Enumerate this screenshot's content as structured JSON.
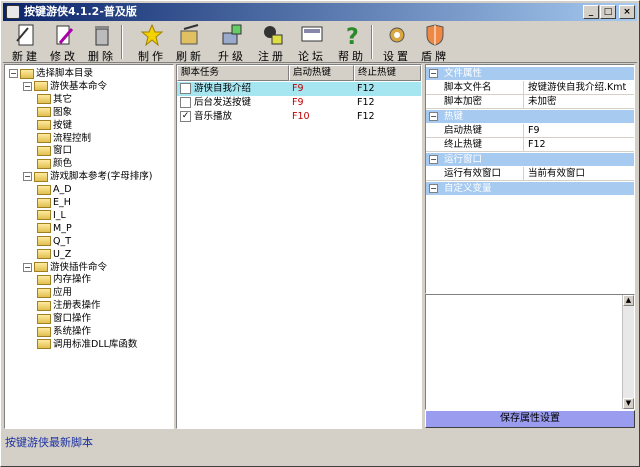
{
  "window": {
    "title": "按键游侠4.1.2-普及版",
    "btn_min": "_",
    "btn_max": "□",
    "btn_close": "×"
  },
  "toolbar": [
    {
      "label": "新建",
      "icon": "new-file-icon"
    },
    {
      "label": "修改",
      "icon": "edit-icon"
    },
    {
      "label": "删除",
      "icon": "trash-icon"
    },
    {
      "label": "制作",
      "icon": "star-icon"
    },
    {
      "label": "刷新",
      "icon": "refresh-icon"
    },
    {
      "label": "升级",
      "icon": "upgrade-icon"
    },
    {
      "label": "注册",
      "icon": "register-icon"
    },
    {
      "label": "论坛",
      "icon": "forum-icon"
    },
    {
      "label": "帮助",
      "icon": "help-icon"
    },
    {
      "label": "设置",
      "icon": "settings-icon"
    },
    {
      "label": "盾牌",
      "icon": "shield-icon"
    }
  ],
  "tree": [
    {
      "label": "选择脚本目录",
      "level": 0,
      "pm": "−"
    },
    {
      "label": "游侠基本命令",
      "level": 1,
      "pm": "−"
    },
    {
      "label": "其它",
      "level": 2
    },
    {
      "label": "图象",
      "level": 2
    },
    {
      "label": "按键",
      "level": 2
    },
    {
      "label": "流程控制",
      "level": 2
    },
    {
      "label": "窗口",
      "level": 2
    },
    {
      "label": "颜色",
      "level": 2
    },
    {
      "label": "游戏脚本参考(字母排序)",
      "level": 1,
      "pm": "−"
    },
    {
      "label": "A_D",
      "level": 2
    },
    {
      "label": "E_H",
      "level": 2
    },
    {
      "label": "I_L",
      "level": 2
    },
    {
      "label": "M_P",
      "level": 2
    },
    {
      "label": "Q_T",
      "level": 2
    },
    {
      "label": "U_Z",
      "level": 2
    },
    {
      "label": "游侠插件命令",
      "level": 1,
      "pm": "−"
    },
    {
      "label": "内存操作",
      "level": 2
    },
    {
      "label": "应用",
      "level": 2
    },
    {
      "label": "注册表操作",
      "level": 2
    },
    {
      "label": "窗口操作",
      "level": 2
    },
    {
      "label": "系统操作",
      "level": 2
    },
    {
      "label": "调用标准DLL库函数",
      "level": 2
    }
  ],
  "tasks": {
    "headers": [
      "脚本任务",
      "启动热键",
      "终止热键"
    ],
    "rows": [
      {
        "name": "游侠自我介绍",
        "start": "F9",
        "stop": "F12",
        "checked": false,
        "selected": true
      },
      {
        "name": "后台发送按键",
        "start": "F9",
        "stop": "F12",
        "checked": false,
        "selected": false
      },
      {
        "name": "音乐播放",
        "start": "F10",
        "stop": "F12",
        "checked": true,
        "selected": false
      }
    ]
  },
  "props": {
    "cat_file": "文件属性",
    "script_file_label": "脚本文件名",
    "script_file_value": "按键游侠自我介绍.Kmt",
    "encrypt_label": "脚本加密",
    "encrypt_value": "未加密",
    "cat_hotkey": "热键",
    "start_label": "启动热键",
    "start_value": "F9",
    "stop_label": "终止热键",
    "stop_value": "F12",
    "cat_window": "运行窗口",
    "window_label": "运行有效窗口",
    "window_value": "当前有效窗口",
    "cat_custom": "自定义变量"
  },
  "save_button": "保存属性设置",
  "status": "按键游侠最新脚本",
  "colors": {
    "title": "#0a246a",
    "selection": "#a6e6f0",
    "hotkey": "#c00000",
    "status": "#1a30a0"
  }
}
